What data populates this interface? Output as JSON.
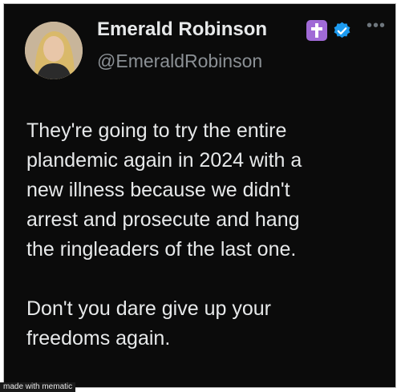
{
  "post": {
    "author": {
      "display_name": "Emerald Robinson",
      "handle": "@EmeraldRobinson",
      "badges": [
        "cross-icon",
        "verified-icon"
      ]
    },
    "more_icon": "•••",
    "text_paragraphs": [
      "They're going to try the entire\nplandemic again in 2024 with a\nnew illness because we didn't\narrest and prosecute and hang\nthe ringleaders of the last one.",
      "Don't you dare give up your\nfreedoms again."
    ]
  },
  "watermark": "made with mematic",
  "colors": {
    "background": "#0b0b0b",
    "text": "#e7e9ea",
    "handle": "#8b9095",
    "verified": "#1d9bf0",
    "cross_badge": "#a06ad6"
  }
}
